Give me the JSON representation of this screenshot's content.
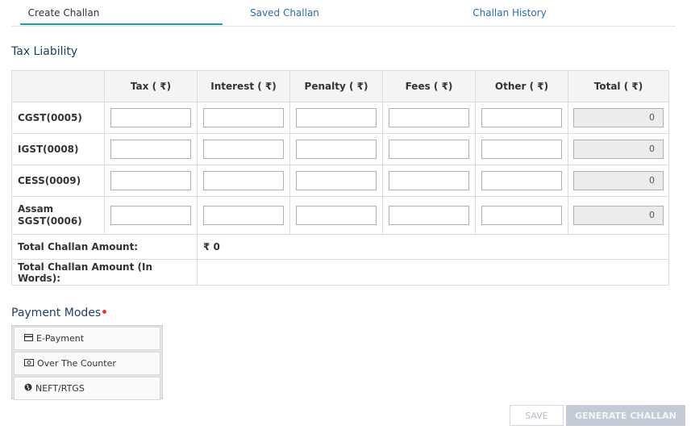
{
  "tabs": [
    {
      "label": "Create Challan",
      "active": true
    },
    {
      "label": "Saved Challan",
      "active": false
    },
    {
      "label": "Challan History",
      "active": false
    }
  ],
  "tax_liability": {
    "title": "Tax Liability",
    "columns": [
      "Tax ( ₹)",
      "Interest ( ₹)",
      "Penalty ( ₹)",
      "Fees ( ₹)",
      "Other ( ₹)",
      "Total ( ₹)"
    ],
    "rows": [
      {
        "label": "CGST(0005)",
        "values": [
          "",
          "",
          "",
          "",
          ""
        ],
        "total": "0"
      },
      {
        "label": "IGST(0008)",
        "values": [
          "",
          "",
          "",
          "",
          ""
        ],
        "total": "0"
      },
      {
        "label": "CESS(0009)",
        "values": [
          "",
          "",
          "",
          "",
          ""
        ],
        "total": "0"
      },
      {
        "label": "Assam SGST(0006)",
        "values": [
          "",
          "",
          "",
          "",
          ""
        ],
        "total": "0"
      }
    ],
    "total_amount_label": "Total Challan Amount:",
    "total_amount_value": "₹ 0",
    "total_words_label": "Total Challan Amount (In Words):",
    "total_words_value": ""
  },
  "payment_modes": {
    "title": "Payment Modes",
    "options": [
      {
        "label": "E-Payment",
        "icon": "credit-card-icon"
      },
      {
        "label": "Over The Counter",
        "icon": "cash-icon"
      },
      {
        "label": "NEFT/RTGS",
        "icon": "globe-icon"
      }
    ]
  },
  "buttons": {
    "save": "SAVE",
    "generate": "GENERATE CHALLAN"
  },
  "colors": {
    "accent": "#17a2b8",
    "link": "#2c6ca8",
    "required": "#e53935",
    "disabled_button": "#c3cbd9"
  }
}
